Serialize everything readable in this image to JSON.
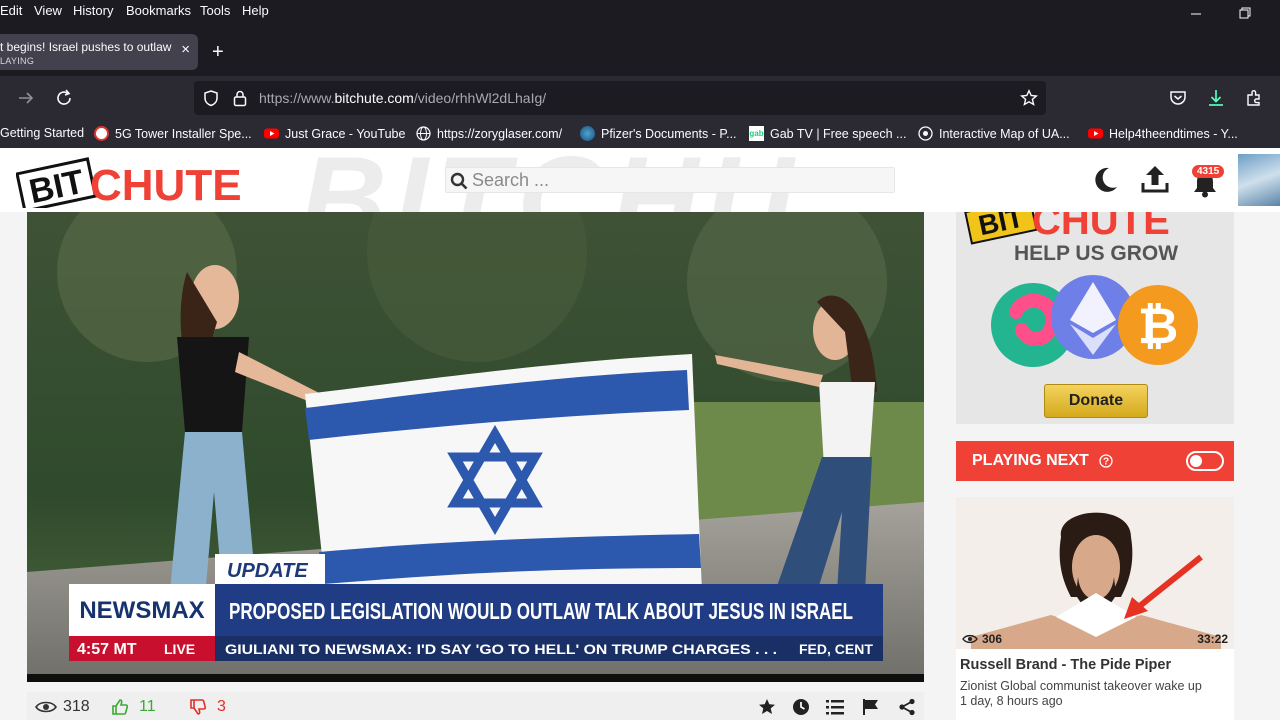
{
  "menubar": {
    "items": [
      "Edit",
      "View",
      "History",
      "Bookmarks",
      "Tools",
      "Help"
    ]
  },
  "tab": {
    "title": "t begins! Israel pushes to outlaw",
    "status": "LAYING",
    "close": "×"
  },
  "newtab": "+",
  "urlbar": {
    "prefix": "https://www.",
    "domain": "bitchute.com",
    "path": "/video/rhhWl2dLhaIg/"
  },
  "bookmarks": [
    {
      "label": "Getting Started",
      "icon": "firefox-icon"
    },
    {
      "label": "5G Tower Installer Spe...",
      "icon": "site-favicon"
    },
    {
      "label": "Just Grace - YouTube",
      "icon": "youtube-icon"
    },
    {
      "label": "https://zoryglaser.com/",
      "icon": "globe-icon"
    },
    {
      "label": "Pfizer's Documents - P...",
      "icon": "site-favicon"
    },
    {
      "label": "Gab TV | Free speech ...",
      "icon": "gab-icon"
    },
    {
      "label": "Interactive Map of UA...",
      "icon": "site-favicon"
    },
    {
      "label": "Help4theendtimes - Y...",
      "icon": "youtube-icon"
    }
  ],
  "site": {
    "logo_left": "BIT",
    "logo_right": "CHUTE",
    "watermark": "BITCHU",
    "search_placeholder": "Search ...",
    "notification_count": "4315"
  },
  "video": {
    "tag": "UPDATE",
    "network": "NEWSMAX",
    "headline": "PROPOSED LEGISLATION WOULD OUTLAW TALK ABOUT JESUS IN ISRAEL",
    "time": "4:57 MT",
    "live": "LIVE",
    "ticker": "GIULIANI TO NEWSMAX: I'D SAY 'GO TO HELL' ON TRUMP CHARGES . . .",
    "ticker2": "FED, CENT"
  },
  "stats": {
    "views": "318",
    "likes": "11",
    "dislikes": "3"
  },
  "sidebar": {
    "donate_logo_left": "BIT",
    "donate_logo_right": "CHUTE",
    "help_text": "HELP US GROW",
    "donate_label": "Donate",
    "playing_next_label": "PLAYING NEXT",
    "next": {
      "views": "306",
      "duration": "33:22",
      "title": "Russell Brand - The Pide Piper",
      "description": "Zionist Global communist takeover wake up",
      "time": "1 day, 8 hours ago"
    }
  },
  "colors": {
    "brand_red": "#ef4136",
    "like_green": "#3aaa35",
    "dislike_red": "#e0302a"
  }
}
